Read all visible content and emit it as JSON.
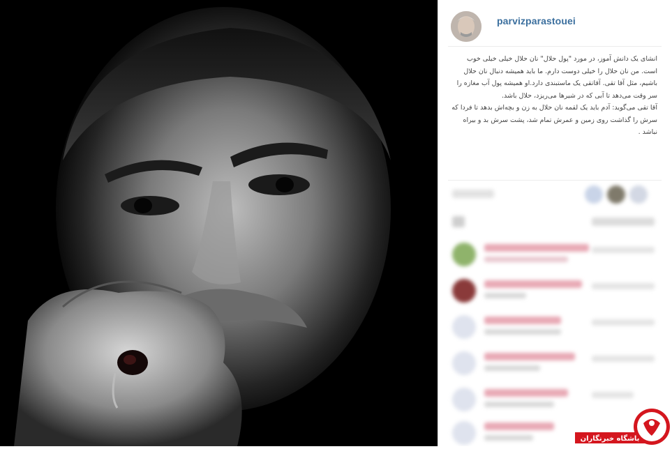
{
  "post": {
    "username": "parvizparastouei",
    "caption": [
      "انشای یک دانش آموز، در مورد \"پول حلال\" نان حلال خیلی خیلی خوب است. من نان حلال را خیلی دوست دارم. ما باید همیشه دنبال نان حلال باشیم، مثل آقا تقی. آقاتقی یک ماستبندی دارد.او همیشه پول آب مغازه را سر وقت می‌دهد تا آبی که در شیرها می‌ریزد، حلال باشد.",
      "آقا تقی می‌گوید: آدم باید یک لقمه نان حلال به زن و بچه‌اش بدهد تا فردا که سرش را گذاشت روی زمین و عمرش تمام شد، پشت سرش بد و بیراه نباشد ."
    ]
  },
  "watermark": {
    "label": "باشگاه خبرنگاران",
    "accent": "#d4161e"
  },
  "colors": {
    "username": "#3b6f9e",
    "caption": "#444444"
  },
  "icons": [
    "user-avatar",
    "blurred-comment-avatars"
  ]
}
